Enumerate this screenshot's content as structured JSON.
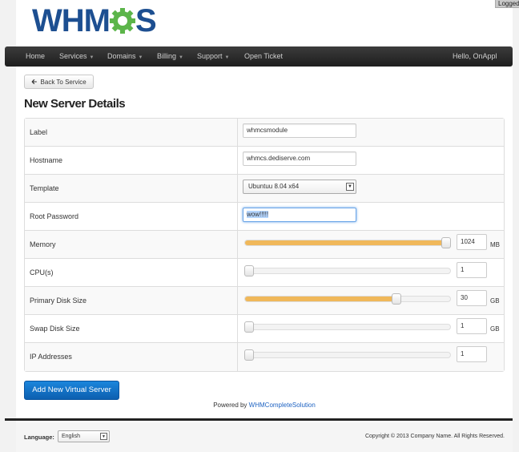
{
  "top_corner": {
    "text": "Logged"
  },
  "logo": {
    "text_left": "WHM",
    "text_right": "S",
    "brand_color": "#1d4f91",
    "gear_color": "#5cb54a"
  },
  "nav": {
    "items": [
      {
        "label": "Home",
        "dropdown": false
      },
      {
        "label": "Services",
        "dropdown": true
      },
      {
        "label": "Domains",
        "dropdown": true
      },
      {
        "label": "Billing",
        "dropdown": true
      },
      {
        "label": "Support",
        "dropdown": true
      },
      {
        "label": "Open Ticket",
        "dropdown": false
      }
    ],
    "user": "Hello, OnAppl"
  },
  "back_button": {
    "label": "Back To Service",
    "icon": "arrow-left-icon"
  },
  "page_title": "New Server Details",
  "form": {
    "label": {
      "label": "Label",
      "value": "whmcsmodule"
    },
    "hostname": {
      "label": "Hostname",
      "value": "whmcs.dediserve.com"
    },
    "template": {
      "label": "Template",
      "value": "Ubuntuu 8.04 x64"
    },
    "root_password": {
      "label": "Root Password",
      "value": "wow!!!!!"
    },
    "memory": {
      "label": "Memory",
      "value": "1024",
      "unit": "MB",
      "level": 1.0
    },
    "cpus": {
      "label": "CPU(s)",
      "value": "1",
      "unit": "",
      "level": 0.0
    },
    "primary_disk": {
      "label": "Primary Disk Size",
      "value": "30",
      "unit": "GB",
      "level": 0.74
    },
    "swap_disk": {
      "label": "Swap Disk Size",
      "value": "1",
      "unit": "GB",
      "level": 0.0
    },
    "ip_addresses": {
      "label": "IP Addresses",
      "value": "1",
      "unit": "",
      "level": 0.0
    }
  },
  "submit_button": {
    "label": "Add New Virtual Server",
    "color": "#1478cf"
  },
  "powered": {
    "prefix": "Powered by",
    "link": "WHMCompleteSolution"
  },
  "footer": {
    "language_label": "Language:",
    "language_value": "English",
    "copyright": "Copyright © 2013 Company Name. All Rights Reserved."
  },
  "colors": {
    "slider_fill": "#f0b85a",
    "navbar": "#2a2a2a"
  }
}
